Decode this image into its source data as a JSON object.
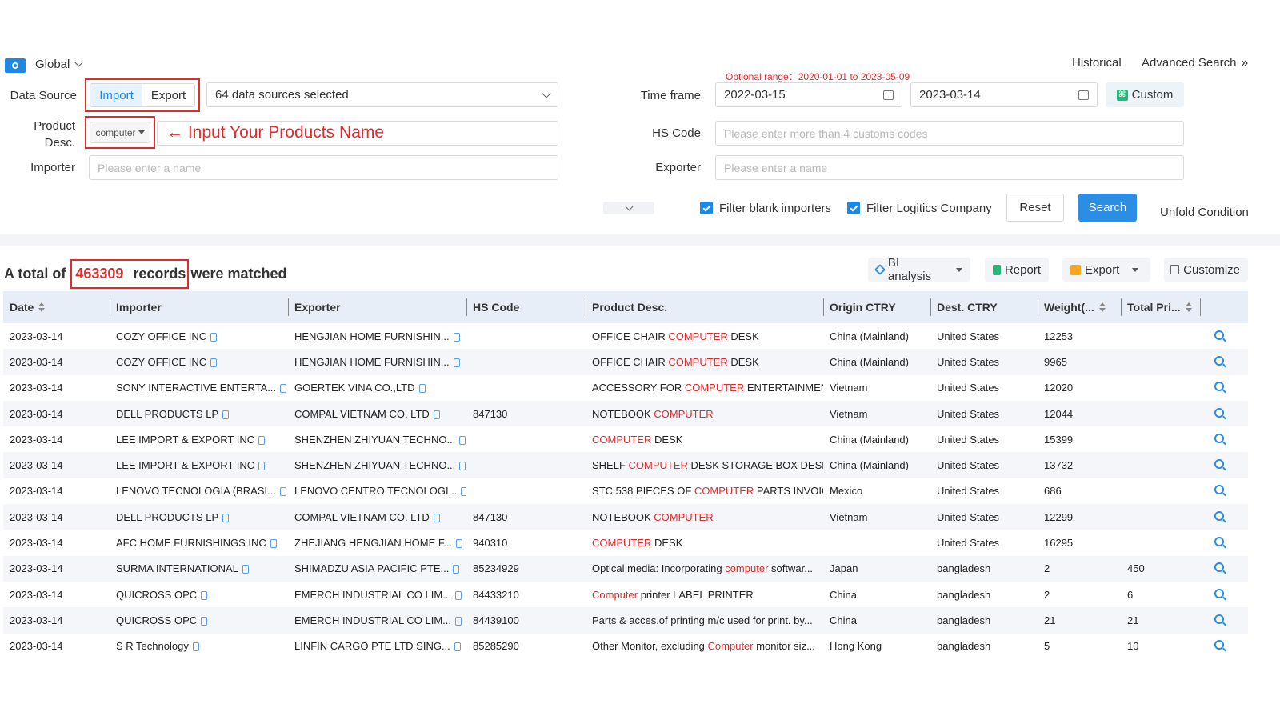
{
  "header": {
    "scope_label": "Global",
    "historical_label": "Historical",
    "advanced_search_label": "Advanced Search",
    "advanced_search_arrows": "»"
  },
  "filters": {
    "data_source_label": "Data Source",
    "import_label": "Import",
    "export_label": "Export",
    "sources_selected": "64 data sources selected",
    "time_frame_label": "Time frame",
    "optional_range": "Optional range：2020-01-01 to 2023-05-09",
    "date_from": "2022-03-15",
    "date_to": "2023-03-14",
    "custom_label": "Custom",
    "product_label_1": "Product",
    "product_label_2": "Desc.",
    "product_select_value": "computer",
    "product_annotation": "← Input Your Products Name",
    "hs_code_label": "HS Code",
    "hs_code_placeholder": "Please enter more than 4 customs codes",
    "importer_label": "Importer",
    "importer_placeholder": "Please enter a name",
    "exporter_label": "Exporter",
    "exporter_placeholder": "Please enter a name",
    "filter_blank_importers": "Filter blank importers",
    "filter_logistics": "Filter Logitics Company",
    "reset_label": "Reset",
    "search_label": "Search",
    "unfold_label": "Unfold Condition"
  },
  "results": {
    "prefix": "A total of",
    "count": "463309",
    "records_word": "records",
    "suffix": "were matched",
    "bi_label": "BI analysis",
    "report_label": "Report",
    "export_label": "Export",
    "customize_label": "Customize"
  },
  "colors": {
    "accent": "#1e88e5",
    "highlight": "#e32a2a"
  },
  "table": {
    "columns": [
      "Date",
      "Importer",
      "Exporter",
      "HS Code",
      "Product Desc.",
      "Origin CTRY",
      "Dest. CTRY",
      "Weight(...",
      "Total Pri..."
    ],
    "rows": [
      {
        "date": "2023-03-14",
        "importer": "COZY OFFICE INC",
        "exporter": "HENGJIAN HOME FURNISHIN...",
        "hs": "",
        "pre": "OFFICE CHAIR ",
        "hl": "COMPUTER",
        "post": " DESK",
        "origin": "China (Mainland)",
        "dest": "United States",
        "weight": "12253",
        "price": ""
      },
      {
        "date": "2023-03-14",
        "importer": "COZY OFFICE INC",
        "exporter": "HENGJIAN HOME FURNISHIN...",
        "hs": "",
        "pre": "OFFICE CHAIR ",
        "hl": "COMPUTER",
        "post": " DESK",
        "origin": "China (Mainland)",
        "dest": "United States",
        "weight": "9965",
        "price": ""
      },
      {
        "date": "2023-03-14",
        "importer": "SONY INTERACTIVE ENTERTA...",
        "exporter": "GOERTEK VINA CO.,LTD",
        "hs": "",
        "pre": "ACCESSORY FOR ",
        "hl": "COMPUTER",
        "post": " ENTERTAINMENT...",
        "origin": "Vietnam",
        "dest": "United States",
        "weight": "12020",
        "price": ""
      },
      {
        "date": "2023-03-14",
        "importer": "DELL PRODUCTS LP",
        "exporter": "COMPAL VIETNAM CO. LTD",
        "hs": "847130",
        "pre": "NOTEBOOK ",
        "hl": "COMPUTER",
        "post": "",
        "origin": "Vietnam",
        "dest": "United States",
        "weight": "12044",
        "price": ""
      },
      {
        "date": "2023-03-14",
        "importer": "LEE IMPORT & EXPORT INC",
        "exporter": "SHENZHEN ZHIYUAN TECHNO...",
        "hs": "",
        "pre": "",
        "hl": "COMPUTER",
        "post": " DESK",
        "origin": "China (Mainland)",
        "dest": "United States",
        "weight": "15399",
        "price": ""
      },
      {
        "date": "2023-03-14",
        "importer": "LEE IMPORT & EXPORT INC",
        "exporter": "SHENZHEN ZHIYUAN TECHNO...",
        "hs": "",
        "pre": "SHELF ",
        "hl": "COMPUTER",
        "post": " DESK STORAGE BOX DESK",
        "origin": "China (Mainland)",
        "dest": "United States",
        "weight": "13732",
        "price": ""
      },
      {
        "date": "2023-03-14",
        "importer": "LENOVO TECNOLOGIA (BRASI...",
        "exporter": "LENOVO CENTRO TECNOLOGI...",
        "hs": "",
        "pre": "STC 538 PIECES OF ",
        "hl": "COMPUTER",
        "post": " PARTS INVOIC...",
        "origin": "Mexico",
        "dest": "United States",
        "weight": "686",
        "price": ""
      },
      {
        "date": "2023-03-14",
        "importer": "DELL PRODUCTS LP",
        "exporter": "COMPAL VIETNAM CO. LTD",
        "hs": "847130",
        "pre": "NOTEBOOK ",
        "hl": "COMPUTER",
        "post": "",
        "origin": "Vietnam",
        "dest": "United States",
        "weight": "12299",
        "price": ""
      },
      {
        "date": "2023-03-14",
        "importer": "AFC HOME FURNISHINGS INC",
        "exporter": "ZHEJIANG HENGJIAN HOME F...",
        "hs": "940310",
        "pre": "",
        "hl": "COMPUTER",
        "post": " DESK",
        "origin": "",
        "dest": "United States",
        "weight": "16295",
        "price": ""
      },
      {
        "date": "2023-03-14",
        "importer": "SURMA INTERNATIONAL",
        "exporter": "SHIMADZU ASIA PACIFIC PTE...",
        "hs": "85234929",
        "pre": "Optical media: Incorporating ",
        "hl": "computer",
        "post": " softwar...",
        "origin": "Japan",
        "dest": "bangladesh",
        "weight": "2",
        "price": "450"
      },
      {
        "date": "2023-03-14",
        "importer": "QUICROSS OPC",
        "exporter": "EMERCH INDUSTRIAL CO LIM...",
        "hs": "84433210",
        "pre": "",
        "hl": "Computer",
        "post": " printer LABEL PRINTER",
        "origin": "China",
        "dest": "bangladesh",
        "weight": "2",
        "price": "6"
      },
      {
        "date": "2023-03-14",
        "importer": "QUICROSS OPC",
        "exporter": "EMERCH INDUSTRIAL CO LIM...",
        "hs": "84439100",
        "pre": "Parts & acces.of printing m/c used for print. by...",
        "hl": "",
        "post": "",
        "origin": "China",
        "dest": "bangladesh",
        "weight": "21",
        "price": "21"
      },
      {
        "date": "2023-03-14",
        "importer": "S R Technology",
        "exporter": "LINFIN CARGO PTE LTD SING...",
        "hs": "85285290",
        "pre": "Other Monitor, excluding ",
        "hl": "Computer",
        "post": " monitor siz...",
        "origin": "Hong Kong",
        "dest": "bangladesh",
        "weight": "5",
        "price": "10"
      }
    ]
  }
}
